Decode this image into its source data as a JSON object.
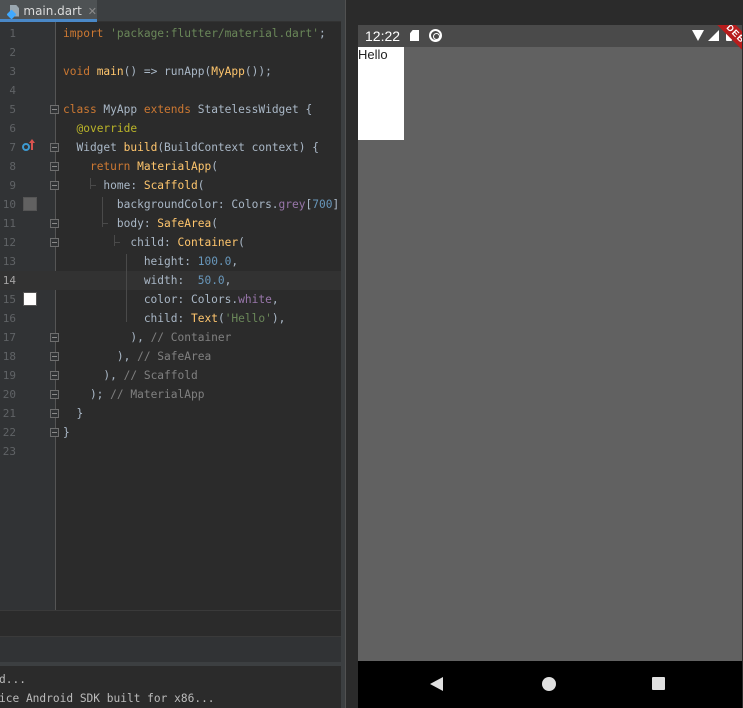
{
  "ide": {
    "tab": {
      "filename": "main.dart",
      "close_glyph": "✕"
    },
    "current_line": 14,
    "lines": [
      {
        "n": "1",
        "html": "<span class=\"kw\">import </span><span class=\"str\">'package:flutter/material.dart'</span>;"
      },
      {
        "n": "2",
        "html": ""
      },
      {
        "n": "3",
        "html": "<span class=\"kw\">void </span><span class=\"fn\">main</span>() => runApp(<span class=\"fn\">MyApp</span>());"
      },
      {
        "n": "4",
        "html": ""
      },
      {
        "n": "5",
        "html": "<span class=\"kw\">class </span>MyApp <span class=\"kw\">extends </span>StatelessWidget {"
      },
      {
        "n": "6",
        "html": "  <span class=\"ann\">@override</span>"
      },
      {
        "n": "7",
        "html": "  Widget <span class=\"fn\">build</span>(BuildContext context) {"
      },
      {
        "n": "8",
        "html": "    <span class=\"kw\">return </span><span class=\"fn\">MaterialApp</span>("
      },
      {
        "n": "9",
        "html": "      home: <span class=\"fn\">Scaffold</span>("
      },
      {
        "n": "10",
        "html": "        backgroundColor: Colors.<span class=\"prop\">grey</span>[<span class=\"num\">700</span>],"
      },
      {
        "n": "11",
        "html": "        body: <span class=\"fn\">SafeArea</span>("
      },
      {
        "n": "12",
        "html": "          child: <span class=\"fn\">Container</span>("
      },
      {
        "n": "13",
        "html": "            height: <span class=\"num\">100.0</span>,"
      },
      {
        "n": "14",
        "html": "            width:  <span class=\"num\">50.0</span>,"
      },
      {
        "n": "15",
        "html": "            color: Colors.<span class=\"prop\">white</span>,"
      },
      {
        "n": "16",
        "html": "            child: <span class=\"fn\">Text</span>(<span class=\"str\">'Hello'</span>),"
      },
      {
        "n": "17",
        "html": "          ), <span class=\"cmt\">// Container</span>"
      },
      {
        "n": "18",
        "html": "        ), <span class=\"cmt\">// SafeArea</span>"
      },
      {
        "n": "19",
        "html": "      ), <span class=\"cmt\">// Scaffold</span>"
      },
      {
        "n": "20",
        "html": "    ); <span class=\"cmt\">// MaterialApp</span>"
      },
      {
        "n": "21",
        "html": "  }"
      },
      {
        "n": "22",
        "html": "}"
      },
      {
        "n": "23",
        "html": ""
      }
    ],
    "fold_lines": [
      5,
      7,
      8,
      9,
      11,
      12,
      17,
      18,
      19,
      20,
      21,
      22
    ],
    "swatches": [
      {
        "line": 10,
        "color": "#616161"
      },
      {
        "line": 15,
        "color": "#ffffff"
      }
    ],
    "console": {
      "line1": "d...",
      "line2": "ice Android SDK built for x86..."
    }
  },
  "emulator": {
    "status": {
      "time": "12:22",
      "debug_label": "DEBUG"
    },
    "app": {
      "text": "Hello",
      "background": "#616161",
      "container_color": "#ffffff"
    },
    "nav": {
      "back_icon": "back-triangle",
      "home_icon": "home-circle",
      "recents_icon": "recents-square"
    }
  }
}
